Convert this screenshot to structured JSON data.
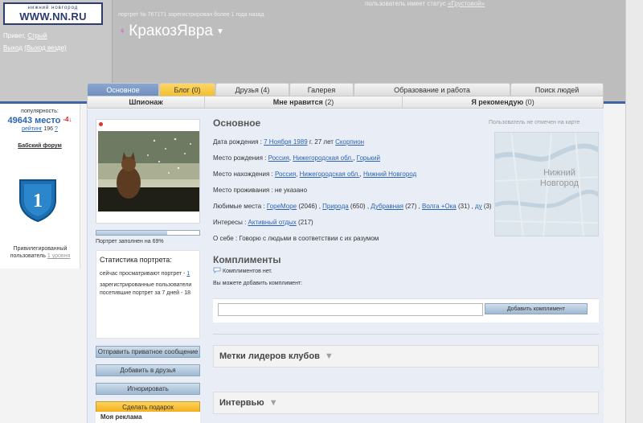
{
  "header": {
    "logo_main": "WWW.NN.RU",
    "logo_sub": "нижний новгород",
    "greeting_prefix": "Привет,",
    "greeting_user": "Стрый",
    "logout": "Выход",
    "logout_everywhere": "(Выход везде)",
    "status_prefix": "пользователь имеет статус",
    "status_value": "«Грустовой»",
    "portrait_meta": "портрет № 767171 зарегистрирован более 1 года назад",
    "nickname": "КракозЯвра"
  },
  "sidebar": {
    "popularity_label": "популярность:",
    "place": "49643 место",
    "place_delta": "-4↓",
    "rating_label": "рейтинг",
    "rating_value": "196",
    "rating_q": "?",
    "forum": "Бабский форум",
    "shield_number": "1",
    "privileged": "Привилегированный пользователь",
    "privileged_level": "1 уровня"
  },
  "tabs_row1": [
    {
      "label": "Основное"
    },
    {
      "label": "Блог (0)"
    },
    {
      "label": "Друзья (4)"
    },
    {
      "label": "Галерея"
    },
    {
      "label": "Образование и работа"
    },
    {
      "label": "Поиск людей"
    }
  ],
  "tabs_row2": [
    {
      "label": "Шпионаж"
    },
    {
      "label": "Мне нравится",
      "count": "(2)"
    },
    {
      "label": "Я рекомендую",
      "count": "(0)"
    }
  ],
  "profile": {
    "filled_text": "Портрет заполнен на 69%",
    "filled_percent": 69,
    "stats_title": "Статистика портрета:",
    "now_viewing": "сейчас просматривают портрет -",
    "now_viewing_count": "1",
    "visitors_text": "зарегистрированные пользователи посетившие портрет за 7 дней - 18",
    "buttons": {
      "private_msg": "Отправить приватное сообщение",
      "add_friend": "Добавить в друзья",
      "ignore": "Игнорировать",
      "gift": "Сделать подарок"
    },
    "my_ads": "Моя реклама"
  },
  "main": {
    "section_title": "Основное",
    "map_note": "Пользователь не отмечен на карте",
    "map_city": "Нижний Новгород",
    "birth_label": "Дата рождения :",
    "birth_date": "7 Ноября 1989",
    "birth_age": "г. 27 лет",
    "birth_sign": "Скорпион",
    "birthplace_label": "Место рождения :",
    "birthplace_country": "Россия",
    "birthplace_region": "Нижегородская обл.",
    "birthplace_city": "Горький",
    "location_label": "Место нахождения :",
    "location_country": "Россия",
    "location_region": "Нижегородская обл.",
    "location_city": "Нижний Новгород",
    "residence_label": "Место проживания :",
    "residence_value": "не указано",
    "fav_label": "Любимые места :",
    "fav_1": "ГореМоре",
    "fav_1c": "(2046) ,",
    "fav_2": "Природа",
    "fav_2c": "(650) ,",
    "fav_3": "Дубравная",
    "fav_3c": "(27) ,",
    "fav_4": "Волга +Ока",
    "fav_4c": "(31) ,",
    "fav_5": "ду",
    "fav_5c": "(3)",
    "interests_label": "Интересы :",
    "interests_value": "Активный отдых",
    "interests_count": "(217)",
    "about_label": "О себе :",
    "about_value": "Говорю с людьми в соответствии с их разумом"
  },
  "compliments": {
    "title": "Комплименты",
    "none": "Комплиментов нет.",
    "can_add": "Вы можете добавить комплимент:",
    "input_value": "",
    "button": "Добавить комплимент"
  },
  "panels": {
    "club_leaders": "Метки лидеров клубов",
    "interview": "Интервью"
  }
}
